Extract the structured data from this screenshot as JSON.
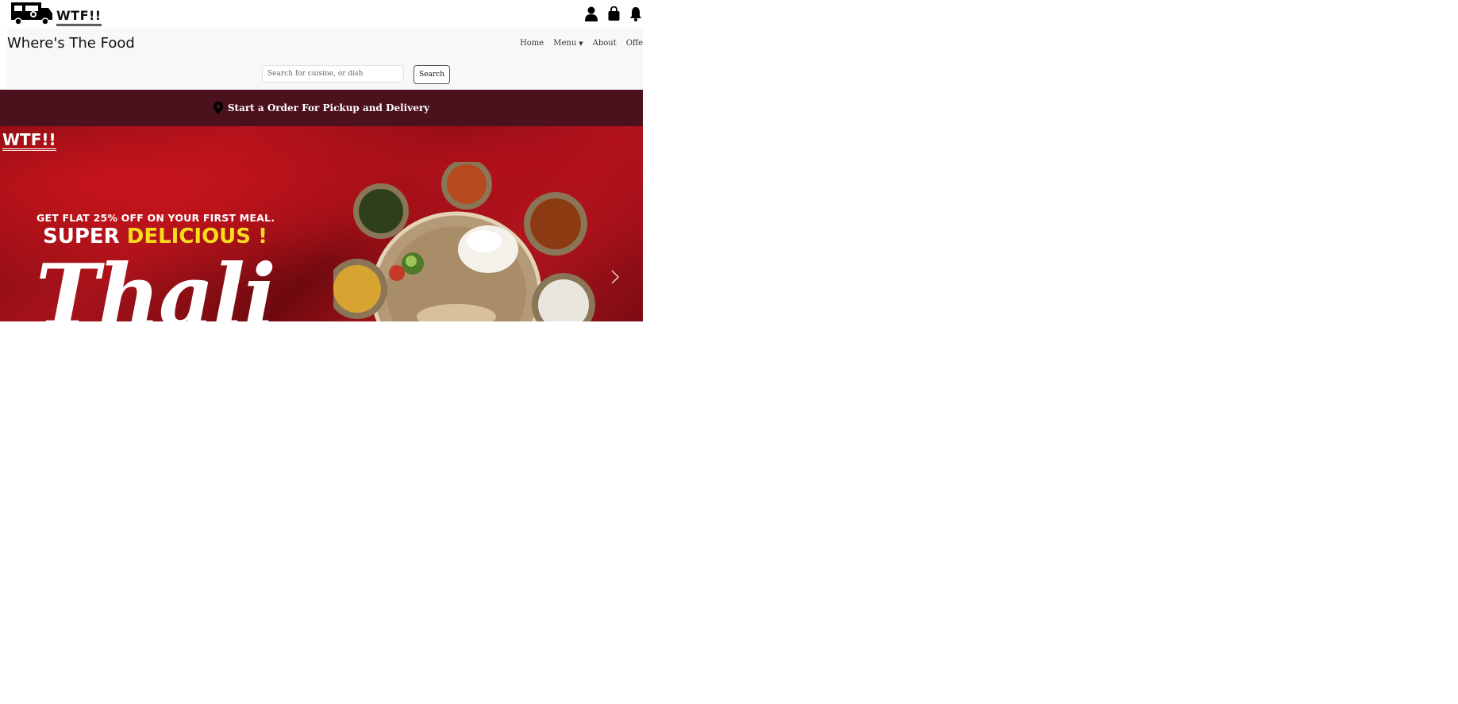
{
  "header": {
    "brand": "WTF!!",
    "icons": [
      "user-icon",
      "shopping-bag-icon",
      "bell-icon"
    ]
  },
  "nav": {
    "site_title": "Where's The Food",
    "items": [
      {
        "label": "Home"
      },
      {
        "label": "Menu"
      },
      {
        "label": "About"
      },
      {
        "label": "Offe"
      }
    ]
  },
  "search": {
    "placeholder": "Search for cuisine, or dish",
    "button_label": "Search"
  },
  "order_banner": {
    "text": "Start a Order For Pickup and Delivery"
  },
  "hero": {
    "logo_text": "WTF!!",
    "offer": "GET FLAT 25% OFF ON YOUR FIRST MEAL.",
    "tagline_prefix": "SUPER ",
    "tagline_highlight": "DELICIOUS !",
    "big_word": "Thali"
  },
  "colors": {
    "banner_bg": "#4b111c",
    "hero_red": "#a8121a",
    "highlight_yellow": "#f9dc1c",
    "nav_bg": "#f7f8fa"
  }
}
